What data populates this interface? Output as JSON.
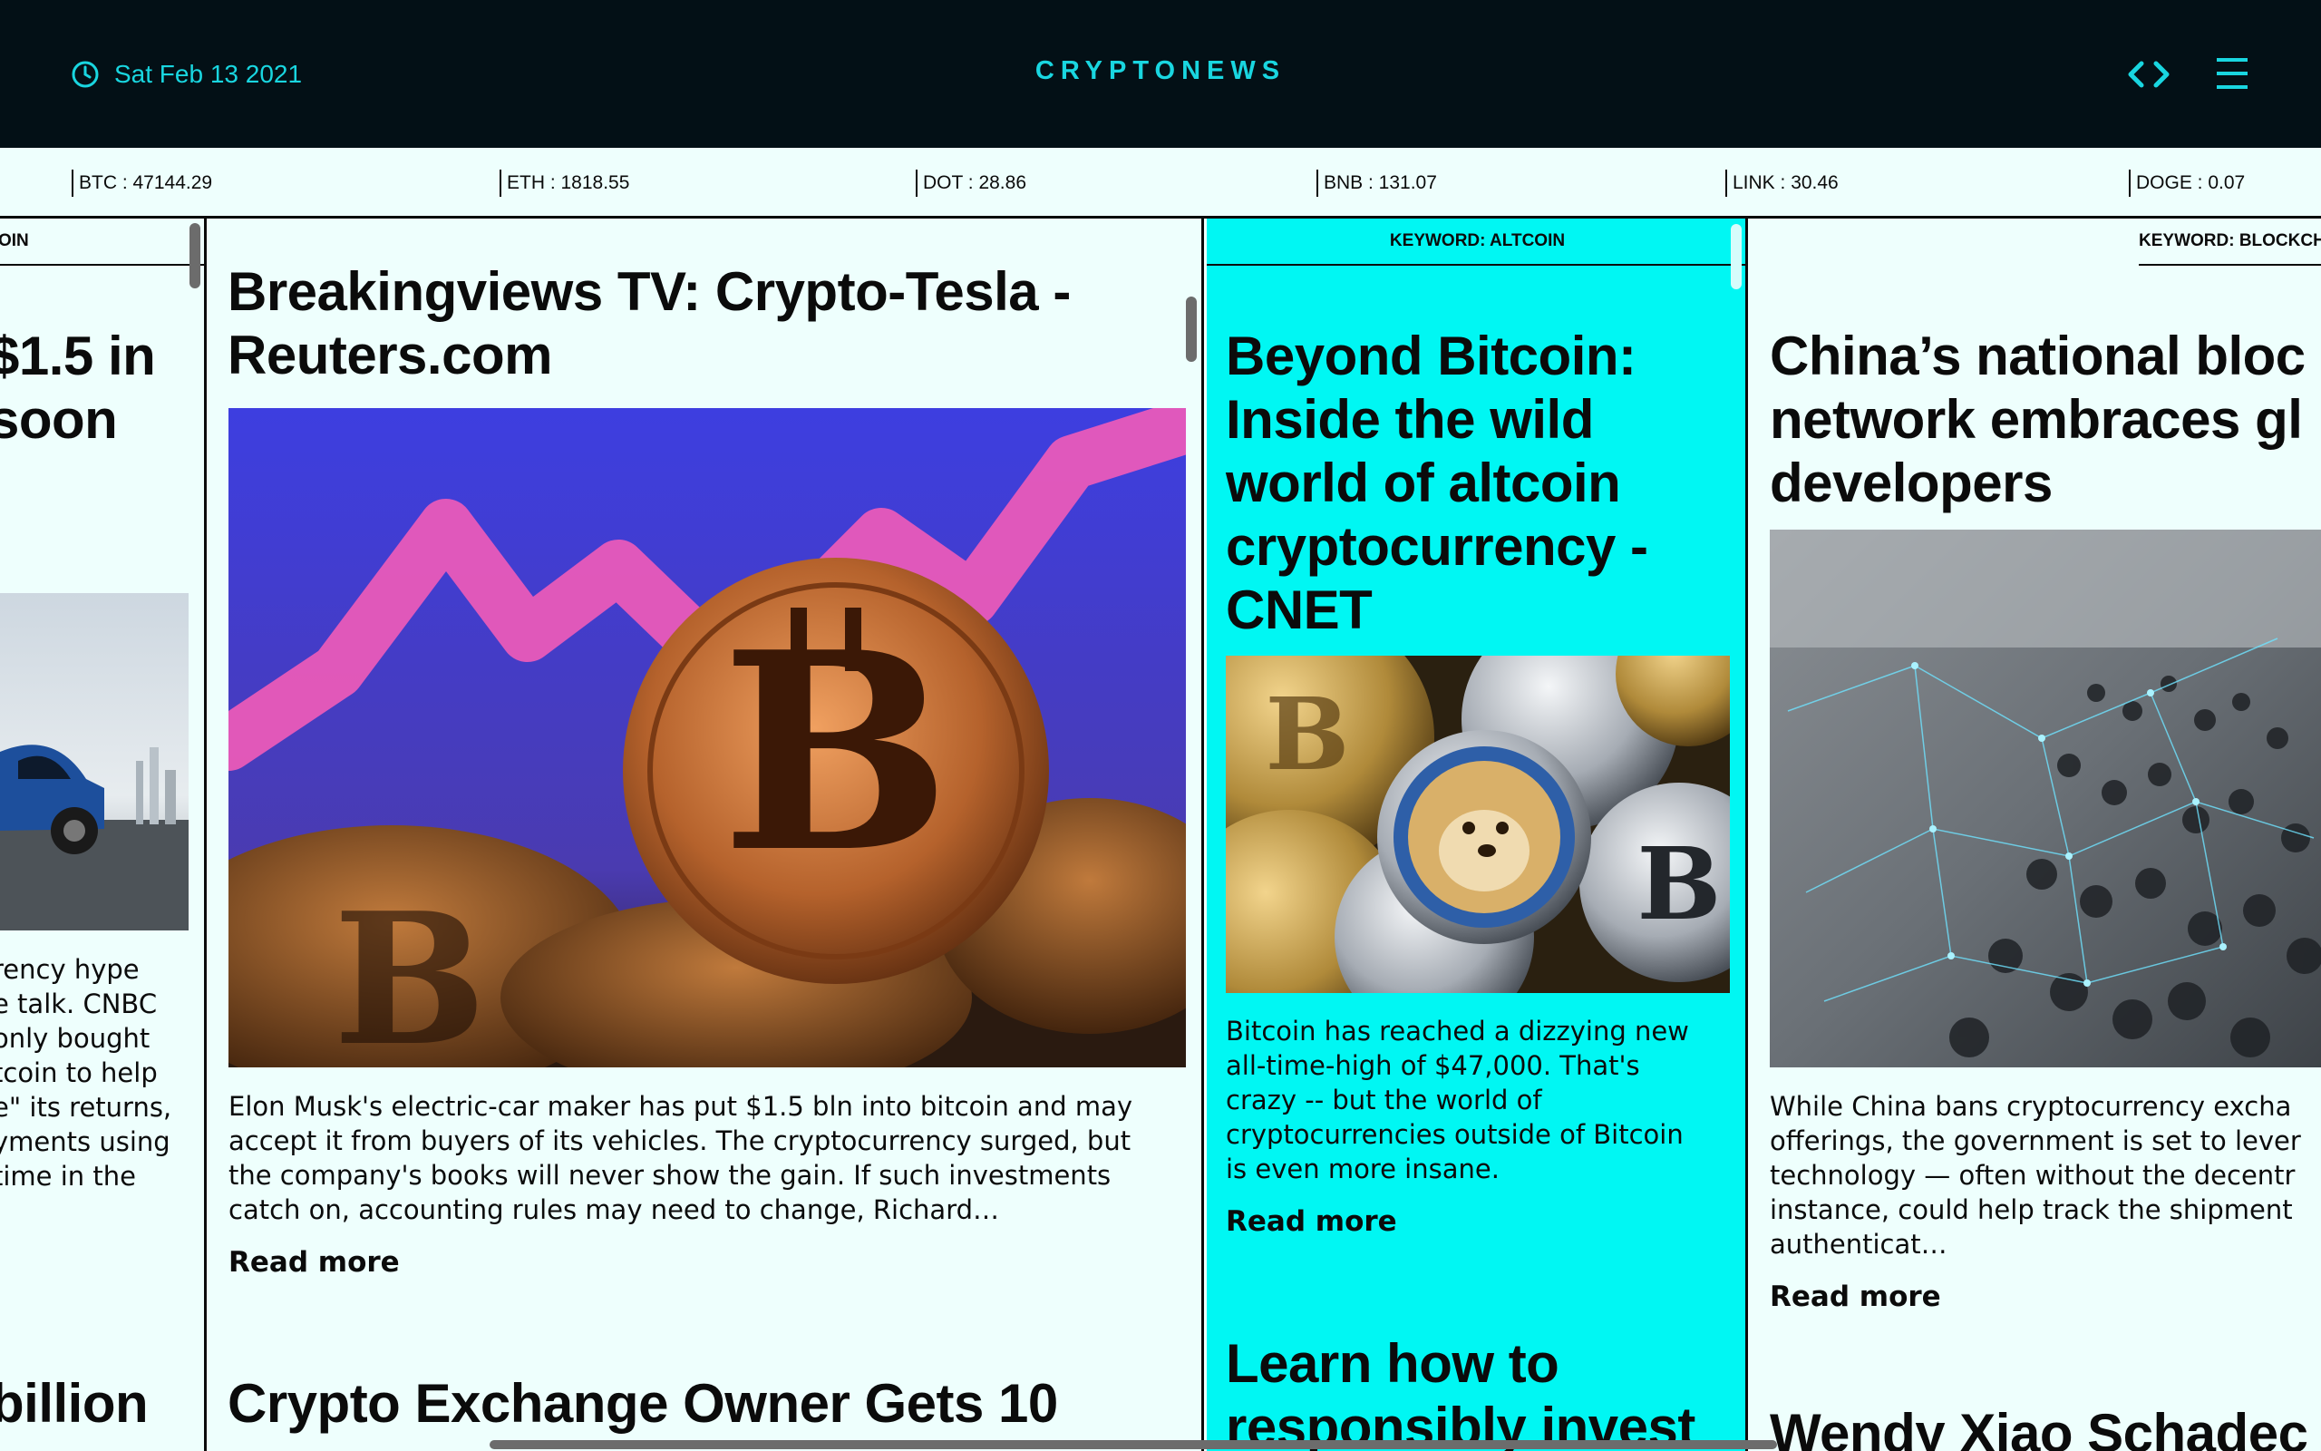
{
  "header": {
    "date": "Sat Feb 13 2021",
    "brand": "CRYPTONEWS",
    "icons": {
      "clock": "clock-icon",
      "code": "code-icon",
      "menu": "hamburger-menu-icon"
    }
  },
  "ticker": [
    {
      "label": "BTC : 47144.29"
    },
    {
      "label": "ETH : 1818.55"
    },
    {
      "label": "DOT : 28.86"
    },
    {
      "label": "BNB : 131.07"
    },
    {
      "label": "LINK : 30.46"
    },
    {
      "label": "DOGE : 0.07"
    }
  ],
  "colors": {
    "header_bg": "#031016",
    "accent": "#19d6e0",
    "page_bg": "#eefffd",
    "highlight_col": "#00f7f3"
  },
  "columns": [
    {
      "keyword": "OIN",
      "article1": {
        "title_lines": [
          "$1.5 in",
          " soon"
        ],
        "summary_lines": [
          "rency hype",
          "e talk. CNBC",
          "only bought",
          "tcoin to help",
          "e\" its returns,",
          "yments using",
          "time in the"
        ]
      },
      "article2": {
        "title": "billion"
      }
    },
    {
      "keyword": "",
      "article1": {
        "title_lines": [
          "Breakingviews TV: Crypto-Tesla -",
          "Reuters.com"
        ],
        "summary_lines": [
          "Elon Musk's electric-car maker has put $1.5 bln into bitcoin and may",
          "accept it from buyers of its vehicles. The cryptocurrency surged, but",
          "the company's books will never show the gain. If such investments",
          "catch on, accounting rules may need to change, Richard…"
        ],
        "read_more": "Read more"
      },
      "article2": {
        "title": "Crypto Exchange Owner Gets 10"
      }
    },
    {
      "keyword": "KEYWORD: ALTCOIN",
      "article1": {
        "title_lines": [
          "Beyond Bitcoin:",
          "Inside the wild",
          "world of altcoin",
          "cryptocurrency -",
          "CNET"
        ],
        "summary_lines": [
          "Bitcoin has reached a dizzying new",
          "all-time-high of $47,000. That's",
          "crazy -- but the world of",
          "cryptocurrencies outside of Bitcoin",
          "is even more insane."
        ],
        "read_more": "Read more"
      },
      "article2": {
        "title_lines": [
          "Learn how to",
          "responsibly invest"
        ]
      }
    },
    {
      "keyword": "KEYWORD: BLOCKCH",
      "article1": {
        "title_lines": [
          "China’s national bloc",
          "network embraces gl",
          "developers"
        ],
        "summary_lines": [
          "While China bans cryptocurrency excha",
          "offerings, the government is set to lever",
          "technology — often without the decentr",
          "instance, could help track the shipment",
          "authenticat…"
        ],
        "read_more": "Read more"
      },
      "article2": {
        "title": "Wendy Xiao Schadec"
      }
    }
  ]
}
